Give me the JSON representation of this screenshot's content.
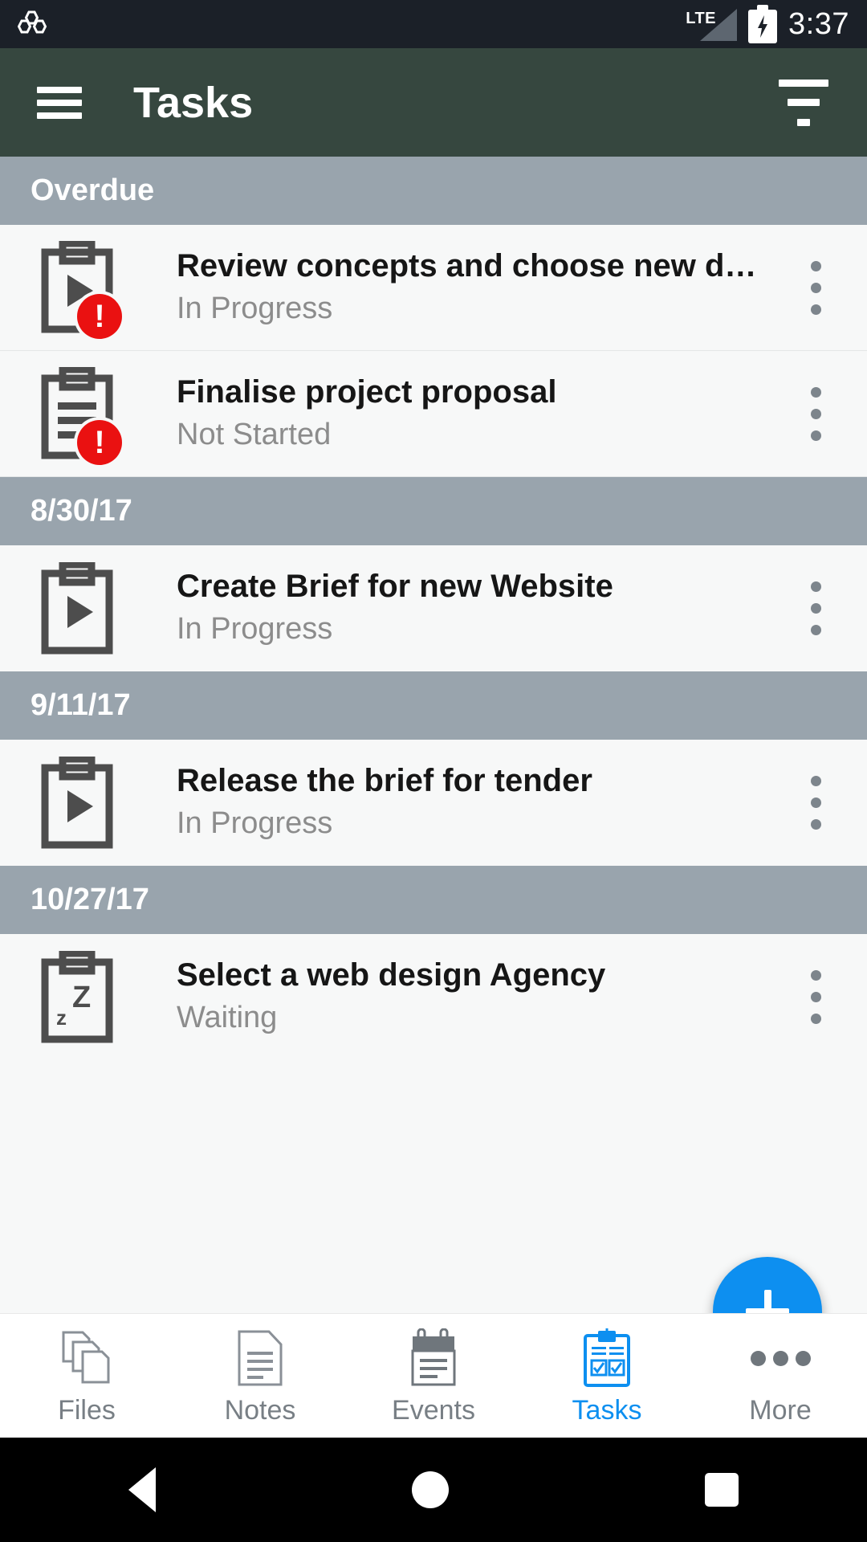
{
  "statusbar": {
    "app_icon": "hexagon-cluster-icon",
    "network_label": "LTE",
    "signal_icon": "signal-triangle-icon",
    "battery_icon": "battery-charging-icon",
    "time": "3:37",
    "background_color": "#1b2028"
  },
  "appbar": {
    "menu_icon": "hamburger-menu-icon",
    "title": "Tasks",
    "filter_icon": "filter-sort-icon",
    "background_color": "#36473f"
  },
  "list": {
    "section_header_color": "#99a4ad",
    "row_background": "#f7f8f8",
    "overdue_badge_color": "#ea1111",
    "sections": [
      {
        "label": "Overdue",
        "tasks": [
          {
            "title": "Review concepts and choose new d…",
            "status": "In Progress",
            "icon": "clipboard-play-icon",
            "overdue": true,
            "badge": "!",
            "menu_icon": "kebab-menu-icon"
          },
          {
            "title": "Finalise project proposal",
            "status": "Not Started",
            "icon": "clipboard-lines-icon",
            "overdue": true,
            "badge": "!",
            "menu_icon": "kebab-menu-icon"
          }
        ]
      },
      {
        "label": "8/30/17",
        "tasks": [
          {
            "title": "Create Brief for new Website",
            "status": "In Progress",
            "icon": "clipboard-play-icon",
            "overdue": false,
            "badge": "",
            "menu_icon": "kebab-menu-icon"
          }
        ]
      },
      {
        "label": "9/11/17",
        "tasks": [
          {
            "title": "Release the brief for tender",
            "status": "In Progress",
            "icon": "clipboard-play-icon",
            "overdue": false,
            "badge": "",
            "menu_icon": "kebab-menu-icon"
          }
        ]
      },
      {
        "label": "10/27/17",
        "tasks": [
          {
            "title": "Select a web design Agency",
            "status": "Waiting",
            "icon": "clipboard-sleep-icon",
            "overdue": false,
            "badge": "",
            "menu_icon": "kebab-menu-icon"
          }
        ]
      }
    ]
  },
  "fab": {
    "icon": "plus-icon",
    "label": "Add task",
    "color": "#0d8ff0"
  },
  "bottomnav": {
    "active_color": "#0d8ff0",
    "inactive_color": "#787f85",
    "items": [
      {
        "label": "Files",
        "icon": "files-stack-icon",
        "active": false
      },
      {
        "label": "Notes",
        "icon": "note-page-icon",
        "active": false
      },
      {
        "label": "Events",
        "icon": "calendar-notepad-icon",
        "active": false
      },
      {
        "label": "Tasks",
        "icon": "clipboard-checklist-icon",
        "active": true
      },
      {
        "label": "More",
        "icon": "ellipsis-icon",
        "active": false
      }
    ]
  },
  "androidnav": {
    "back_icon": "back-triangle-icon",
    "home_icon": "home-circle-icon",
    "recents_icon": "recents-square-icon"
  }
}
